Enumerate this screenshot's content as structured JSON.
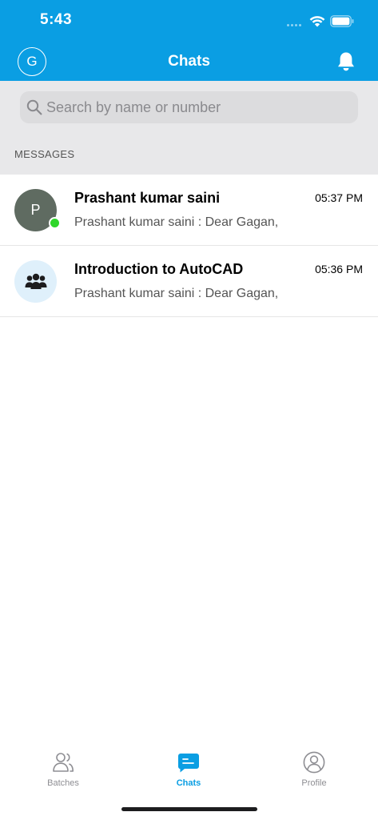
{
  "colors": {
    "primary": "#0a9ee3",
    "search_bg": "#e8e8ea",
    "search_field": "#dcdcde",
    "online": "#2fd62a",
    "avatar_gray": "#5f6b61",
    "group_avatar_bg": "#dff0fb",
    "tab_inactive": "#8e8e93"
  },
  "status_bar": {
    "time": "5:43"
  },
  "navbar": {
    "user_initial": "G",
    "title": "Chats",
    "bell_icon": "bell-icon"
  },
  "search": {
    "placeholder": "Search by name or number"
  },
  "section": {
    "label": "MESSAGES"
  },
  "chats": [
    {
      "avatar_initial": "P",
      "name": "Prashant kumar saini",
      "time": "05:37 PM",
      "preview": "Prashant kumar saini : Dear Gagan,",
      "online": true
    },
    {
      "avatar_icon": "group-icon",
      "name": "Introduction to AutoCAD",
      "time": "05:36 PM",
      "preview": "Prashant kumar saini : Dear Gagan,"
    }
  ],
  "tabs": [
    {
      "label": "Batches",
      "icon": "users-icon",
      "active": false
    },
    {
      "label": "Chats",
      "icon": "chat-icon",
      "active": true
    },
    {
      "label": "Profile",
      "icon": "profile-icon",
      "active": false
    }
  ]
}
